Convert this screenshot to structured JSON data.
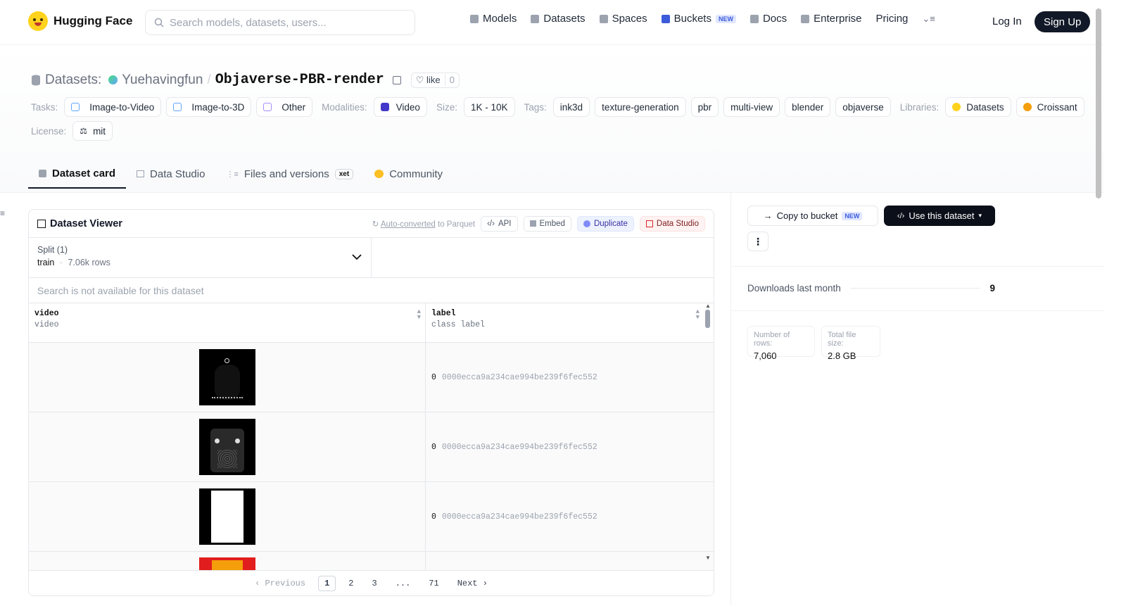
{
  "brand": {
    "name": "Hugging Face"
  },
  "search": {
    "placeholder": "Search models, datasets, users..."
  },
  "nav": {
    "models": "Models",
    "datasets": "Datasets",
    "spaces": "Spaces",
    "buckets": "Buckets",
    "buckets_badge": "NEW",
    "docs": "Docs",
    "enterprise": "Enterprise",
    "pricing": "Pricing",
    "login": "Log In",
    "signup": "Sign Up"
  },
  "repo": {
    "kind": "Datasets:",
    "owner": "Yuehavingfun",
    "sep": "/",
    "name": "Objaverse-PBR-render",
    "like_label": "like",
    "like_count": "0"
  },
  "tags": {
    "tasks_label": "Tasks:",
    "tasks": [
      "Image-to-Video",
      "Image-to-3D",
      "Other"
    ],
    "modalities_label": "Modalities:",
    "modality": "Video",
    "size_label": "Size:",
    "size": "1K - 10K",
    "tags_label": "Tags:",
    "tags": [
      "ink3d",
      "texture-generation",
      "pbr",
      "multi-view",
      "blender",
      "objaverse"
    ],
    "libraries_label": "Libraries:",
    "libraries": [
      "Datasets",
      "Croissant"
    ],
    "license_label": "License:",
    "license": "mit"
  },
  "tabs": {
    "card": "Dataset card",
    "studio": "Data Studio",
    "files": "Files and versions",
    "files_badge": "xet",
    "community": "Community"
  },
  "viewer": {
    "title": "Dataset Viewer",
    "auto_converted": "Auto-converted",
    "to_parquet": "to Parquet",
    "api": "API",
    "embed": "Embed",
    "duplicate": "Duplicate",
    "data_studio": "Data Studio",
    "split_label": "Split (1)",
    "split_name": "train",
    "split_dot": "·",
    "split_rows": "7.06k rows",
    "search_na": "Search is not available for this dataset",
    "columns": [
      {
        "name": "video",
        "type": "video"
      },
      {
        "name": "label",
        "type": "class label"
      }
    ],
    "rows": [
      {
        "label_id": "0",
        "label_name": "0000ecca9a234cae994be239f6fec552"
      },
      {
        "label_id": "0",
        "label_name": "0000ecca9a234cae994be239f6fec552"
      },
      {
        "label_id": "0",
        "label_name": "0000ecca9a234cae994be239f6fec552"
      }
    ],
    "pager": {
      "previous": "Previous",
      "pages": [
        "1",
        "2",
        "3"
      ],
      "ellipsis": "...",
      "last": "71",
      "next": "Next"
    }
  },
  "sidebar": {
    "copy_bucket": "Copy to bucket",
    "copy_badge": "NEW",
    "use_dataset": "Use this dataset",
    "downloads_label": "Downloads last month",
    "downloads_value": "9",
    "rows_label": "Number of rows:",
    "rows_value": "7,060",
    "size_label": "Total file size:",
    "size_value": "2.8 GB"
  },
  "colors": {
    "accent_dark": "#111827",
    "brand_yellow": "#ffd21e",
    "nav_blue": "#3b5bdb"
  }
}
